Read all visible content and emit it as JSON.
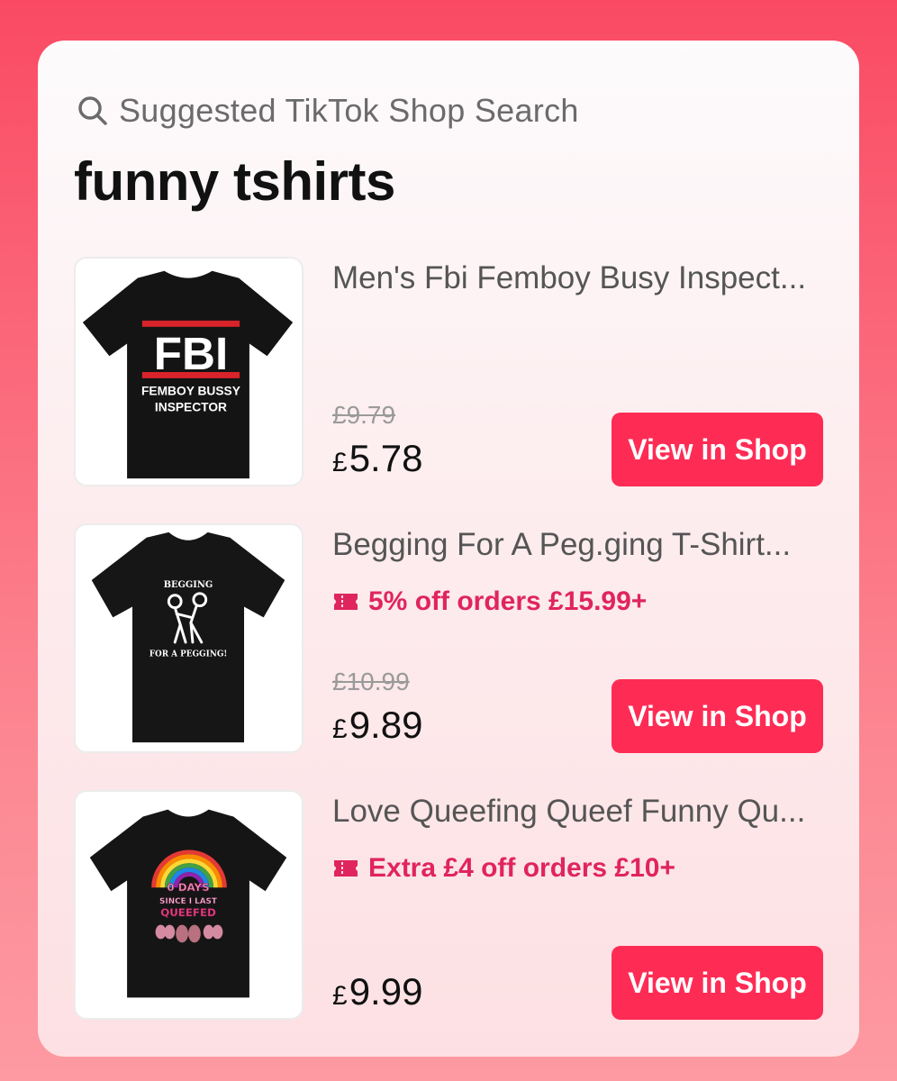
{
  "header": {
    "search_label": "Suggested TikTok Shop Search",
    "query": "funny tshirts"
  },
  "products": [
    {
      "title": "Men's Fbi Femboy Busy Inspect...",
      "promo": "",
      "old_price": "9.79",
      "price": "5.78",
      "currency": "£",
      "button": "View in Shop",
      "shirt_text": [
        "FBI",
        "FEMBOY BUSSY",
        "INSPECTOR"
      ]
    },
    {
      "title": "Begging For A Peg.ging T-Shirt...",
      "promo": "5% off orders £15.99+",
      "old_price": "10.99",
      "price": "9.89",
      "currency": "£",
      "button": "View in Shop",
      "shirt_text": [
        "BEGGING",
        "FOR A PEGGING!"
      ]
    },
    {
      "title": "Love Queefing Queef Funny Qu...",
      "promo": "Extra £4 off orders £10+",
      "old_price": "",
      "price": "9.99",
      "currency": "£",
      "button": "View in Shop",
      "shirt_text": [
        "0 DAYS",
        "SINCE I LAST",
        "QUEEFED"
      ]
    }
  ],
  "colors": {
    "accent": "#fe2c55",
    "promo": "#e0245e",
    "background": "#fa4a63"
  }
}
